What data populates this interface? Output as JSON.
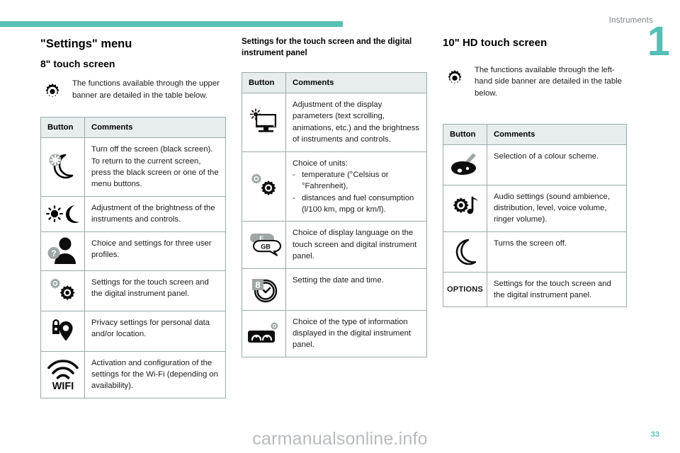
{
  "header": {
    "section_label": "Instruments",
    "chapter_number": "1",
    "accent_color": "#55c0b5"
  },
  "footer": {
    "watermark": "carmanualsonline.info",
    "page_number": "33"
  },
  "column_left": {
    "title": "\"Settings\" menu",
    "subtitle": "8\" touch screen",
    "intro_icon": "gear-icon",
    "intro_text": "The functions available through the upper banner are detailed in the table below.",
    "table": {
      "headers": [
        "Button",
        "Comments"
      ],
      "rows": [
        {
          "icon": "moon-star-screen-off-icon",
          "comment": "Turn off the screen (black screen).\nTo return to the current screen, press the black screen or one of the menu buttons."
        },
        {
          "icon": "sun-moon-brightness-icon",
          "comment": "Adjustment of the brightness of the instruments and controls."
        },
        {
          "icon": "user-profile-question-icon",
          "comment": "Choice and settings for three user profiles."
        },
        {
          "icon": "double-gear-icon",
          "comment": "Settings for the touch screen and the digital instrument panel."
        },
        {
          "icon": "privacy-lock-location-icon",
          "comment": "Privacy settings for personal data and/or location."
        },
        {
          "icon": "wifi-icon",
          "icon_label": "WIFI",
          "comment": "Activation and configuration of the settings for the Wi-Fi (depending on availability)."
        }
      ]
    }
  },
  "column_middle": {
    "title": "Settings for the touch screen and the digital instrument panel",
    "table": {
      "headers": [
        "Button",
        "Comments"
      ],
      "rows": [
        {
          "icon": "monitor-brightness-icon",
          "comment": "Adjustment of the display parameters (text scrolling, animations, etc.) and the brightness of instruments and controls."
        },
        {
          "icon": "double-gear-icon",
          "comment_lead": "Choice of units:",
          "comment_items": [
            "temperature (°Celsius or °Fahrenheit),",
            "distances and fuel consumption (l/100 km, mpg or km/l)."
          ],
          "dash": "-"
        },
        {
          "icon": "language-speech-bubble-icon",
          "icon_labels": [
            "F",
            "GB"
          ],
          "comment": "Choice of display language on the touch screen and digital instrument panel."
        },
        {
          "icon": "date-time-clock-icon",
          "icon_label": "8",
          "comment": "Setting the date and time."
        },
        {
          "icon": "instrument-panel-gear-icon",
          "comment": "Choice of the type of information displayed in the digital instrument panel."
        }
      ]
    }
  },
  "column_right": {
    "title": "10\" HD touch screen",
    "intro_icon": "gear-icon",
    "intro_text": "The functions available through the left-hand side banner are detailed in the table below.",
    "table": {
      "headers": [
        "Button",
        "Comments"
      ],
      "rows": [
        {
          "icon": "colour-palette-icon",
          "comment": "Selection of a colour scheme."
        },
        {
          "icon": "gear-music-note-icon",
          "comment": "Audio settings (sound ambience, distribution, level, voice volume, ringer volume)."
        },
        {
          "icon": "moon-icon",
          "comment": "Turns the screen off."
        },
        {
          "icon": "options-text-icon",
          "icon_label": "OPTIONS",
          "comment": "Settings for the touch screen and the digital instrument panel."
        }
      ]
    }
  }
}
